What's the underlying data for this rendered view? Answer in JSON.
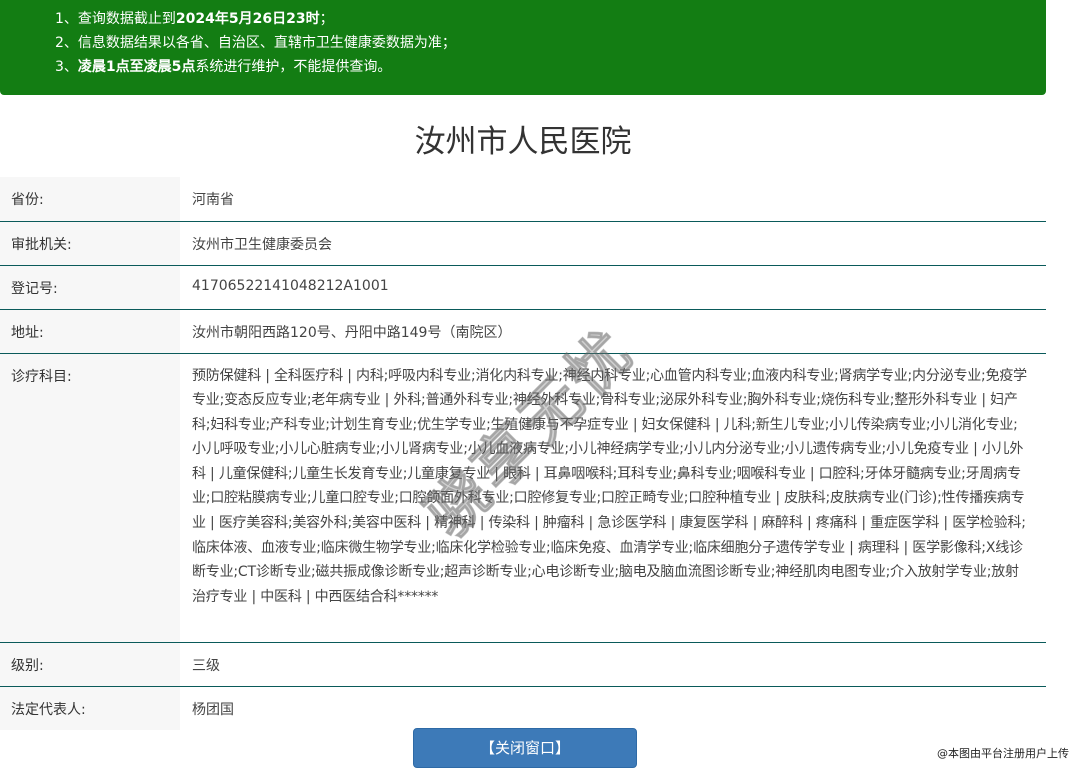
{
  "notice": {
    "lines": [
      {
        "prefix": "1、查询数据截止到",
        "bold": "2024年5月26日23时",
        "suffix": "；"
      },
      {
        "prefix": "2、信息数据结果以各省、自治区、直辖市卫生健康委数据为准；",
        "bold": "",
        "suffix": ""
      },
      {
        "prefix": "3、",
        "bold": "凌晨1点至凌晨5点",
        "suffix": "系统进行维护，不能提供查询。"
      }
    ]
  },
  "hospital_name": "汝州市人民医院",
  "fields": {
    "province": {
      "label": "省份:",
      "value": "河南省"
    },
    "authority": {
      "label": "审批机关:",
      "value": "汝州市卫生健康委员会"
    },
    "reg_no": {
      "label": "登记号:",
      "value": "41706522141048212A1001"
    },
    "address": {
      "label": "地址:",
      "value": "汝州市朝阳西路120号、丹阳中路149号（南院区）"
    },
    "departments": {
      "label": "诊疗科目:",
      "value": "预防保健科 | 全科医疗科 | 内科;呼吸内科专业;消化内科专业;神经内科专业;心血管内科专业;血液内科专业;肾病学专业;内分泌专业;免疫学专业;变态反应专业;老年病专业 | 外科;普通外科专业;神经外科专业;骨科专业;泌尿外科专业;胸外科专业;烧伤科专业;整形外科专业 | 妇产科;妇科专业;产科专业;计划生育专业;优生学专业;生殖健康与不孕症专业 | 妇女保健科 | 儿科;新生儿专业;小儿传染病专业;小儿消化专业;小儿呼吸专业;小儿心脏病专业;小儿肾病专业;小儿血液病专业;小儿神经病学专业;小儿内分泌专业;小儿遗传病专业;小儿免疫专业 | 小儿外科 | 儿童保健科;儿童生长发育专业;儿童康复专业 | 眼科 | 耳鼻咽喉科;耳科专业;鼻科专业;咽喉科专业 | 口腔科;牙体牙髓病专业;牙周病专业;口腔粘膜病专业;儿童口腔专业;口腔颌面外科专业;口腔修复专业;口腔正畸专业;口腔种植专业 | 皮肤科;皮肤病专业(门诊);性传播疾病专业 | 医疗美容科;美容外科;美容中医科 | 精神科 | 传染科 | 肿瘤科 | 急诊医学科 | 康复医学科 | 麻醉科 | 疼痛科 | 重症医学科 | 医学检验科;临床体液、血液专业;临床微生物学专业;临床化学检验专业;临床免疫、血清学专业;临床细胞分子遗传学专业 | 病理科 | 医学影像科;X线诊断专业;CT诊断专业;磁共振成像诊断专业;超声诊断专业;心电诊断专业;脑电及脑血流图诊断专业;神经肌肉电图专业;介入放射学专业;放射治疗专业 | 中医科 | 中西医结合科******"
    },
    "level": {
      "label": "级别:",
      "value": "三级"
    },
    "legal_rep": {
      "label": "法定代表人:",
      "value": "杨团国"
    }
  },
  "close_button_label": "【关闭窗口】",
  "watermark_text": "骁享无忧",
  "credit_text": "@本图由平台注册用户上传",
  "colors": {
    "notice_bg": "#137d13",
    "button_bg": "#3d7ab8",
    "row_border": "#0a5a5a"
  }
}
